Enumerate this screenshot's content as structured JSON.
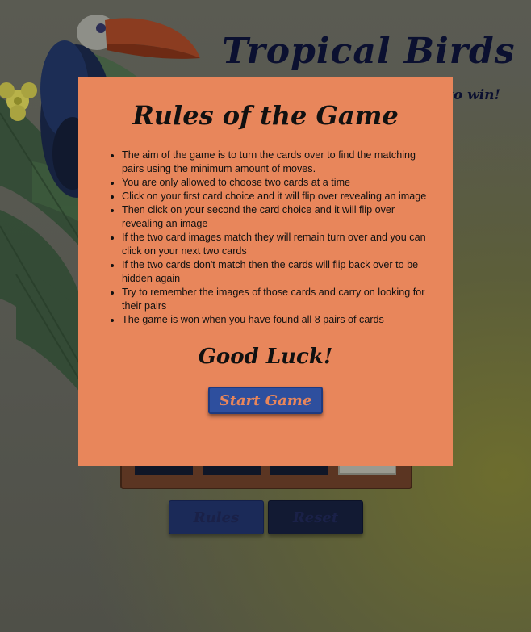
{
  "header": {
    "title": "Tropical Birds",
    "subtitle": "to win!"
  },
  "board": {
    "card_count_visible": 4
  },
  "controls": {
    "rules_label": "Rules",
    "reset_label": "Reset"
  },
  "modal": {
    "title": "Rules of the Game",
    "rules": [
      "The aim of the game is to turn the cards over to find the matching pairs using the minimum amount of moves.",
      "You are only allowed to choose two cards at a time",
      "Click on your first card choice and it will flip over revealing an image",
      "Then click on your second the card choice and it will flip over revealing an image",
      "If the two card images match they will remain turn over and you can click on your next two cards",
      "If the two cards don't match then the cards will flip back over to be hidden again",
      "Try to remember the images of those cards and carry on looking for their pairs",
      "The game is won when you have found all 8 pairs of cards"
    ],
    "closing": "Good Luck!",
    "start_label": "Start Game"
  },
  "colors": {
    "modal_bg": "#e8865b",
    "start_button": "#2e4f9e",
    "title_text": "#0b1030"
  },
  "icons": [
    "toucan-illustration",
    "tropical-leaves",
    "plumeria-flower"
  ]
}
